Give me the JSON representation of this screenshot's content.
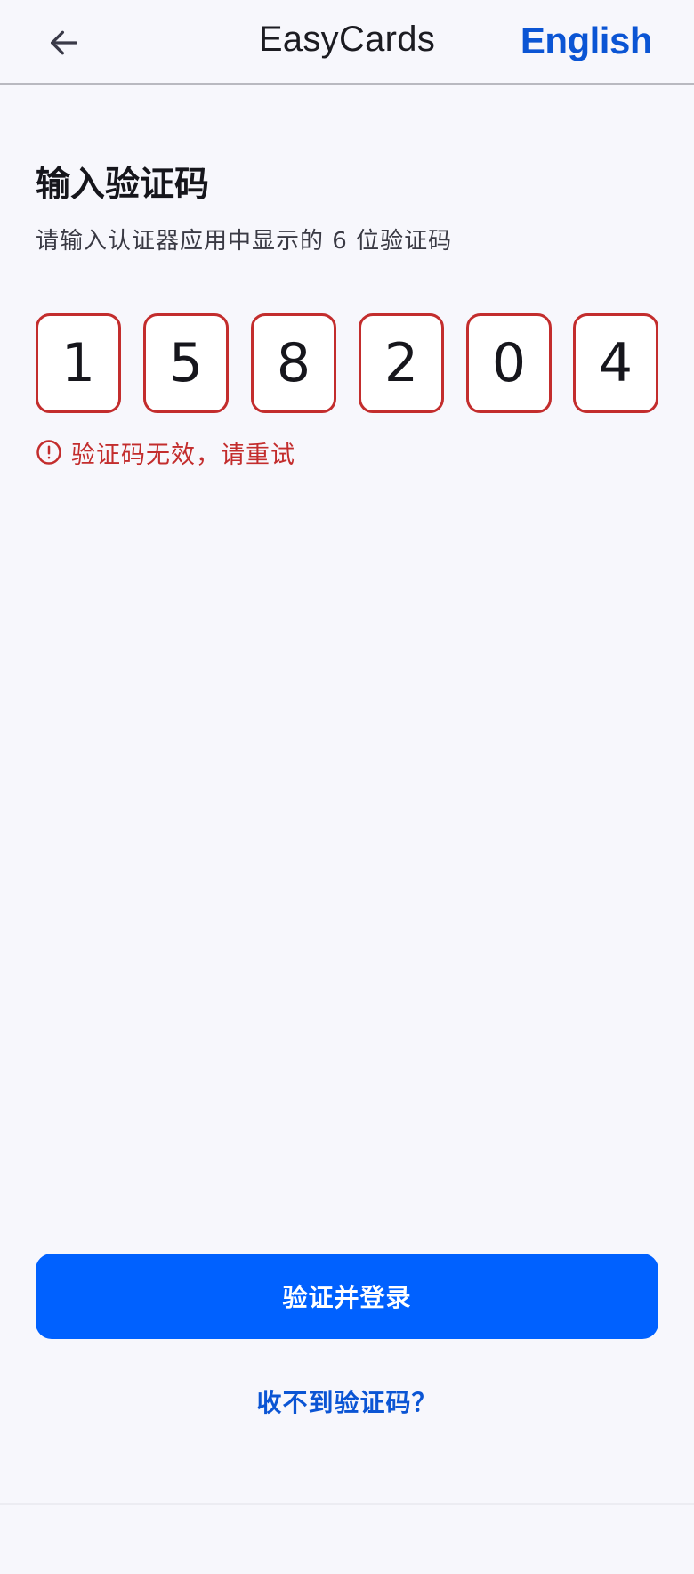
{
  "header": {
    "back_icon": "arrow-left-icon",
    "title": "EasyCards",
    "language_label": "English"
  },
  "main": {
    "heading": "输入验证码",
    "subtitle": "请输入认证器应用中显示的 6 位验证码",
    "code_digits": [
      "1",
      "5",
      "8",
      "2",
      "0",
      "4"
    ],
    "error_icon": "alert-circle-icon",
    "error_message": "验证码无效，请重试",
    "submit_label": "验证并登录",
    "resend_label": "收不到验证码？"
  },
  "colors": {
    "accent": "#0061ff",
    "link": "#0b55d4",
    "error": "#c32d2d",
    "background": "#f7f7fc"
  }
}
